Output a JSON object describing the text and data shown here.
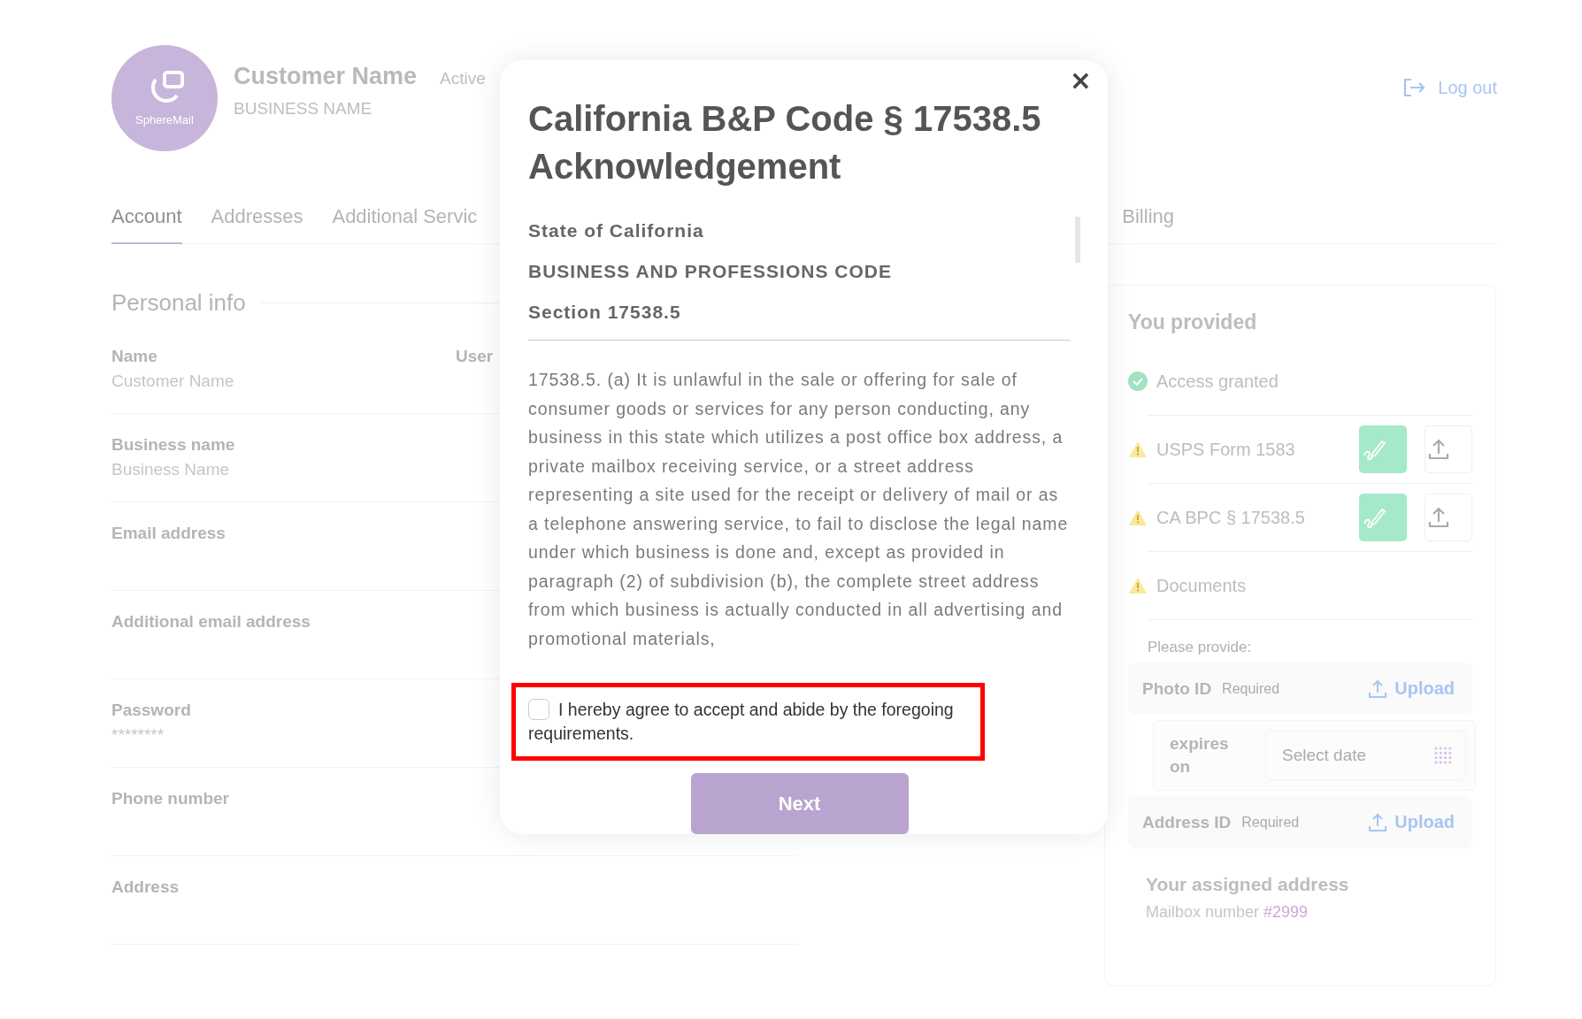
{
  "header": {
    "logo_text": "SphereMail",
    "customer_name": "Customer Name",
    "status": "Active",
    "business_name": "BUSINESS NAME",
    "logout": "Log out"
  },
  "tabs": [
    {
      "label": "Account",
      "selected": true
    },
    {
      "label": "Addresses",
      "selected": false
    },
    {
      "label": "Additional Servic",
      "selected": false
    },
    {
      "label": "Billing",
      "selected": false
    }
  ],
  "personal_info": {
    "title": "Personal info",
    "side_label": "User",
    "fields": [
      {
        "label": "Name",
        "value": "Customer Name"
      },
      {
        "label": "Business name",
        "value": "Business Name"
      },
      {
        "label": "Email address"
      },
      {
        "label": "Additional email address"
      },
      {
        "label": "Password",
        "value": "********"
      },
      {
        "label": "Phone number"
      },
      {
        "label": "Address"
      }
    ]
  },
  "provided": {
    "title": "You provided",
    "items": [
      {
        "kind": "status",
        "complete": true,
        "label": "Access granted"
      },
      {
        "kind": "form",
        "complete": false,
        "label": "USPS Form 1583"
      },
      {
        "kind": "form",
        "complete": false,
        "label": "CA BPC § 17538.5"
      },
      {
        "kind": "status",
        "complete": false,
        "label": "Documents"
      }
    ],
    "request_title": "Please provide:",
    "documents": [
      {
        "kind": "upload",
        "label": "Photo ID",
        "note": "Required",
        "action": "Upload"
      },
      {
        "kind": "date",
        "label": "expires on",
        "placeholder": "Select date"
      },
      {
        "kind": "upload",
        "label": "Address ID",
        "note": "Required",
        "action": "Upload"
      }
    ],
    "assigned": {
      "title": "Your assigned address",
      "text": "Mailbox number",
      "number": "#2999"
    }
  },
  "modal": {
    "title": "California B&P Code § 17538.5 Acknowledgement",
    "headings": [
      "State of California",
      "BUSINESS AND PROFESSIONS CODE",
      "Section 17538.5"
    ],
    "body": "17538.5. (a)  It is unlawful in the sale or offering for sale of consumer goods or services for any person conducting, any business in this state which utilizes a post office box address, a private mailbox receiving service, or a street address representing a site used for the receipt or delivery of mail or as a telephone answering service, to fail to disclose the legal name under which business is done and, except as provided in paragraph (2) of subdivision (b), the complete street address from which business is actually conducted in all advertising and promotional materials,",
    "agreement": {
      "checked": false,
      "highlighted": true,
      "label": "I hereby agree to accept and abide by the foregoing requirements."
    },
    "button": "Next",
    "close": "×"
  }
}
